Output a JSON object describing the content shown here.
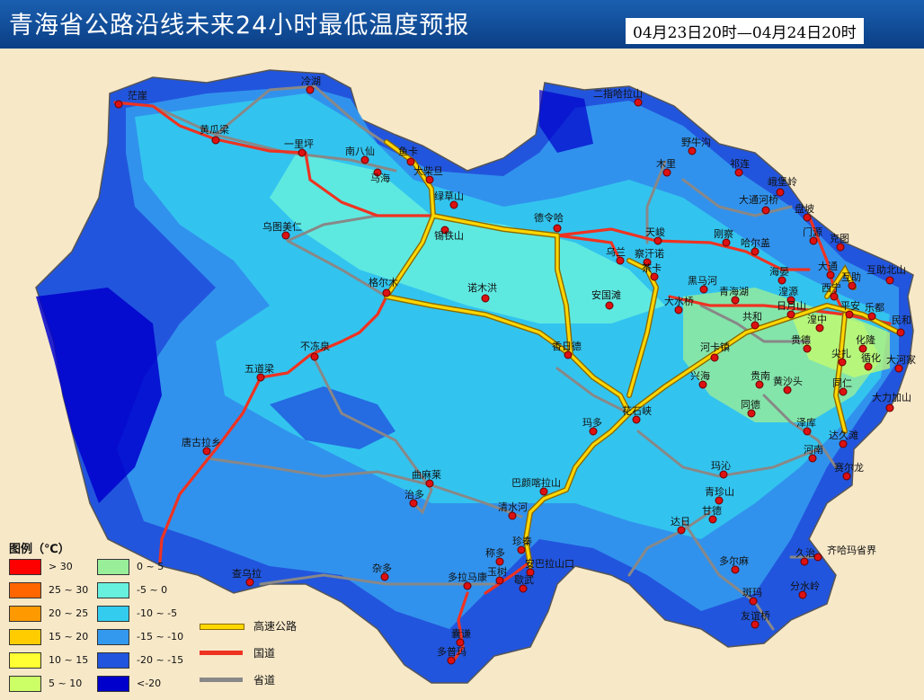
{
  "header": {
    "title": "青海省公路沿线未来24小时最低温度预报",
    "date_range": "04月23日20时—04月24日20时"
  },
  "legend": {
    "title": "图例（℃）",
    "items": [
      {
        "label": "> 30",
        "color": "#ff0000"
      },
      {
        "label": "25 ~ 30",
        "color": "#ff6600"
      },
      {
        "label": "20 ~ 25",
        "color": "#ff9900"
      },
      {
        "label": "15 ~ 20",
        "color": "#ffcc00"
      },
      {
        "label": "10 ~ 15",
        "color": "#ffff33"
      },
      {
        "label": "5 ~ 10",
        "color": "#ccff66"
      },
      {
        "label": "0 ~ 5",
        "color": "#99ee99"
      },
      {
        "label": "-5 ~ 0",
        "color": "#66f0dd"
      },
      {
        "label": "-10 ~ -5",
        "color": "#33ccee"
      },
      {
        "label": "-15 ~ -10",
        "color": "#3399ee"
      },
      {
        "label": "-20 ~ -15",
        "color": "#2255dd"
      },
      {
        "label": "<-20",
        "color": "#0000cc"
      }
    ]
  },
  "road_legend": {
    "items": [
      {
        "label": "高速公路",
        "color": "#ffd700"
      },
      {
        "label": "国道",
        "color": "#ee3322"
      },
      {
        "label": "省道",
        "color": "#888888"
      }
    ]
  },
  "places": [
    "茫崖",
    "冷湖",
    "二指哈拉山",
    "黄瓜梁",
    "一里坪",
    "南八仙",
    "鱼卡",
    "马海",
    "大柴旦",
    "野牛沟",
    "木里",
    "祁连",
    "峨堡岭",
    "大通河桥",
    "绿草山",
    "锡铁山",
    "乌图美仁",
    "德令哈",
    "天峻",
    "刚察",
    "哈尔盖",
    "盘坡",
    "门源",
    "克图",
    "乌兰",
    "察汗诺",
    "茶卡",
    "黑马河",
    "海晏",
    "大通",
    "互助北山",
    "格尔木",
    "诺木洪",
    "安国滩",
    "青海湖",
    "湟源",
    "西宁",
    "互助",
    "大水桥",
    "日月山",
    "平安",
    "乐都",
    "民和",
    "共和",
    "湟中",
    "化隆",
    "香日德",
    "贵德",
    "尖扎",
    "循化",
    "大河家",
    "不冻泉",
    "河卡镇",
    "兴海",
    "贵南",
    "黄沙头",
    "同仁",
    "五道梁",
    "大力加山",
    "花石峡",
    "同德",
    "玛多",
    "泽库",
    "达久滩",
    "唐古拉乡",
    "河南",
    "玛沁",
    "赛尔龙",
    "曲麻莱",
    "巴颜喀拉山",
    "治多",
    "青珍山",
    "甘德",
    "清水河",
    "达日",
    "珍秦",
    "称多",
    "久治",
    "齐哈玛省界",
    "查乌拉",
    "杂多",
    "玉树",
    "安巴拉山口",
    "多拉马康",
    "歇武",
    "多尔麻",
    "分水岭",
    "斑玛",
    "友谊桥",
    "囊谦",
    "多普玛"
  ]
}
